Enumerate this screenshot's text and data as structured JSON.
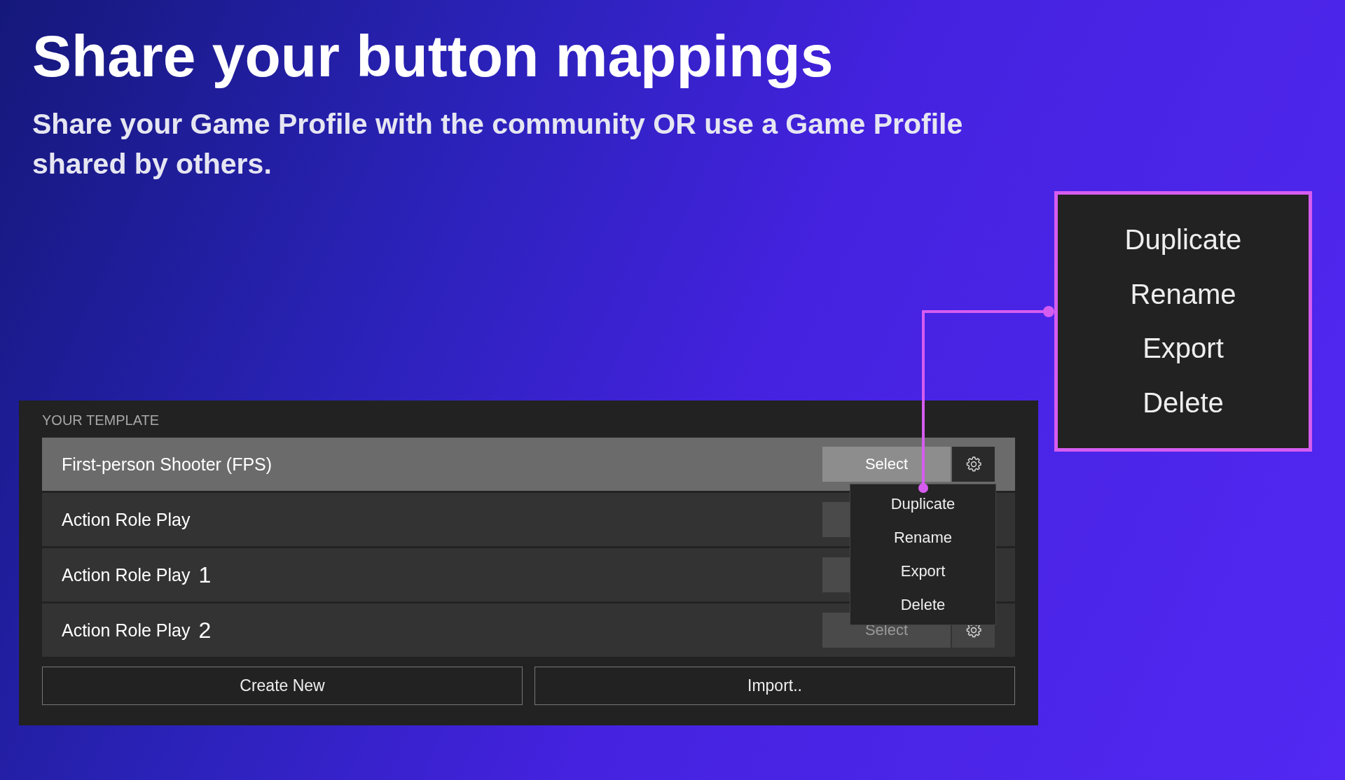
{
  "title": "Share your button mappings",
  "subtitle": "Share your Game Profile with the community OR use a Game Profile shared by others.",
  "panel": {
    "heading": "YOUR TEMPLATE",
    "rows": [
      {
        "name": "First-person Shooter (FPS)",
        "selected": true,
        "select_label": "Select"
      },
      {
        "name": "Action Role Play",
        "selected": false
      },
      {
        "name": "Action Role Play",
        "suffix": "1",
        "selected": false
      },
      {
        "name": "Action Role Play",
        "suffix": "2",
        "selected": false,
        "select_label": "Select"
      }
    ],
    "context_menu": [
      "Duplicate",
      "Rename",
      "Export",
      "Delete"
    ],
    "buttons": [
      "Create New",
      "Import.."
    ]
  },
  "callout": {
    "items": [
      "Duplicate",
      "Rename",
      "Export",
      "Delete"
    ]
  }
}
